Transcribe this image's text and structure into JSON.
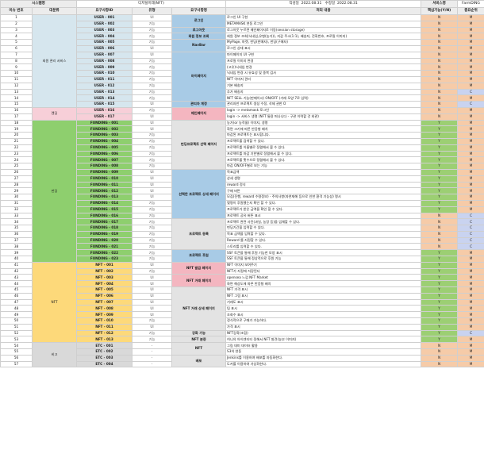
{
  "header": {
    "system_label": "시스템명",
    "system_value": "디지털미레(NFT)",
    "author_label": "작성일",
    "author_date": "2022.08.31",
    "revised_label": "수정일",
    "revised_date": "2022.08.31",
    "service_label": "서비스명",
    "service_value": "FarmDING"
  },
  "columns": [
    "이슈 번호",
    "대분류",
    "요구사항ID",
    "유형",
    "요구사항명",
    "처리 내용",
    "핵심기능(Y/N)",
    "중요순위"
  ],
  "colors": {
    "member": "#d6e6ee",
    "rental": "#f7cfd8",
    "funding": "#8ecf6e",
    "nft": "#fdd97a",
    "etc": "#d9d9d9",
    "name_blue": "#a8cbe6",
    "name_pink": "#f4b6c0",
    "name_green": "#a8d98a",
    "name_gray": "#e3e3e3",
    "core_y": "#9ccf73",
    "core_n": "#f6cba8",
    "prio_c": "#c9d3f0"
  },
  "rows": [
    {
      "no": "1",
      "id": "USER - 001",
      "type": "UI",
      "desc": "로그인 UI 구현",
      "core": "N",
      "prio": "M"
    },
    {
      "no": "2",
      "id": "USER - 002",
      "type": "기능",
      "desc": "METAMASK 연동 로그인",
      "core": "N",
      "prio": "M"
    },
    {
      "no": "3",
      "id": "USER - 003",
      "type": "기능",
      "desc": "로그아웃 누르면 메인페이지로 이동(session storage)",
      "core": "N",
      "prio": "M"
    },
    {
      "no": "4",
      "id": "USER - 004",
      "type": "기능",
      "desc": "회원 정보 조회(닉네임,유형(농가)), 지갑 주소(1:1), 배송지, 전화번호, 프로필 이미지)",
      "core": "N",
      "prio": "M"
    },
    {
      "no": "5",
      "id": "USER - 005",
      "type": "기능",
      "desc": "MyPage, 마켓, 펀딩(판매자), 펀딩(구매자)",
      "core": "N",
      "prio": "M"
    },
    {
      "no": "6",
      "id": "USER - 006",
      "type": "UI",
      "desc": "로그인 상태 표시",
      "core": "N",
      "prio": "M"
    },
    {
      "no": "7",
      "id": "USER - 007",
      "type": "UI",
      "desc": "마이페이지 UI 구현",
      "core": "N",
      "prio": "M"
    },
    {
      "no": "8",
      "id": "USER - 008",
      "type": "기능",
      "desc": "프로필 이미지 변경",
      "core": "N",
      "prio": "M"
    },
    {
      "no": "9",
      "id": "USER - 009",
      "type": "기능",
      "desc": "(고유)닉네임 변경",
      "core": "N",
      "prio": "M"
    },
    {
      "no": "10",
      "id": "USER - 010",
      "type": "기능",
      "desc": "닉네임 변경 시 유효성 및 중복 검사",
      "core": "N",
      "prio": "M"
    },
    {
      "no": "11",
      "id": "USER - 011",
      "type": "기능",
      "desc": "NFT 이미지 관리",
      "core": "N",
      "prio": "M"
    },
    {
      "no": "12",
      "id": "USER - 012",
      "type": "기능",
      "desc": "기본 배송지",
      "core": "N",
      "prio": "M"
    },
    {
      "no": "13",
      "id": "USER - 013",
      "type": "기능",
      "desc": "추가 배송지",
      "core": "N",
      "prio": "C"
    },
    {
      "no": "14",
      "id": "USER - 014",
      "type": "기능",
      "desc": "NFT SELL 기능(판매이시) ON/OFF (거래 모양 7로 입력)",
      "core": "N",
      "prio": "M"
    },
    {
      "no": "15",
      "id": "USER - 015",
      "type": "UI",
      "desc": "관리자만 프로젝트 생성 수정, 삭제 권한 O",
      "core": "N",
      "prio": "C"
    },
    {
      "no": "16",
      "id": "USER - 016",
      "type": "기능",
      "desc": "login -> metamask 로그인",
      "core": "N",
      "prio": "M"
    },
    {
      "no": "17",
      "id": "USER - 017",
      "type": "UI",
      "desc": "login -> 서비스 생명 (NFT 통용 떠나니다 - 구관 이력할 것 외관)",
      "core": "N",
      "prio": "M"
    },
    {
      "no": "18",
      "id": "FUNDING - 001",
      "type": "UI",
      "desc": "농가(or 농작물) 이미지, 생명",
      "core": "Y",
      "prio": "M"
    },
    {
      "no": "19",
      "id": "FUNDING - 002",
      "type": "UI",
      "desc": "화면 크기에 따른 반응형 배치",
      "core": "Y",
      "prio": "M"
    },
    {
      "no": "20",
      "id": "FUNDING - 003",
      "type": "기능",
      "desc": "마감된 프로젝트는 표시합니다.",
      "core": "Y",
      "prio": "M"
    },
    {
      "no": "21",
      "id": "FUNDING - 004",
      "type": "기능",
      "desc": "프로젝트를 검색할 수 있다.",
      "core": "Y",
      "prio": "M"
    },
    {
      "no": "22",
      "id": "FUNDING - 005",
      "type": "기능",
      "desc": "프로젝트를 이름별로 정렬해서 볼 수 있다.",
      "core": "Y",
      "prio": "M"
    },
    {
      "no": "23",
      "id": "FUNDING - 006",
      "type": "기능",
      "desc": "프로젝트를 마감 기한별로 정렬해서 볼 수 있다.",
      "core": "Y",
      "prio": "M"
    },
    {
      "no": "24",
      "id": "FUNDING - 007",
      "type": "기능",
      "desc": "프로젝트를 횟수으로 정렬해서 볼 수 있다.",
      "core": "Y",
      "prio": "M"
    },
    {
      "no": "25",
      "id": "FUNDING - 008",
      "type": "기능",
      "desc": "마감 ON/OFF별로 보는 기능",
      "core": "Y",
      "prio": "M"
    },
    {
      "no": "26",
      "id": "FUNDING - 009",
      "type": "UI",
      "desc": "목표금액",
      "core": "Y",
      "prio": "M"
    },
    {
      "no": "27",
      "id": "FUNDING - 010",
      "type": "UI",
      "desc": "상세 생명",
      "core": "Y",
      "prio": "M"
    },
    {
      "no": "28",
      "id": "FUNDING - 011",
      "type": "UI",
      "desc": "reward 정식",
      "core": "Y",
      "prio": "M"
    },
    {
      "no": "29",
      "id": "FUNDING - 012",
      "type": "UI",
      "desc": "구매 버튼",
      "core": "Y",
      "prio": "M"
    },
    {
      "no": "30",
      "id": "FUNDING - 013",
      "type": "UI",
      "desc": "모집(진행, reward 수령정보) - 주의사항(자연재해 등으로 인한 환격 기능성) 명시",
      "core": "Y",
      "prio": "M"
    },
    {
      "no": "31",
      "id": "FUNDING - 014",
      "type": "기능",
      "desc": "몇명이 후원했는지 확인 할 수 있다.",
      "core": "Y",
      "prio": "M"
    },
    {
      "no": "32",
      "id": "FUNDING - 015",
      "type": "기능",
      "desc": "프로젝트가 받은 금액을 확인 할 수 있다.",
      "core": "Y",
      "prio": "M"
    },
    {
      "no": "33",
      "id": "FUNDING - 016",
      "type": "기능",
      "desc": "프로젝트 공유 버튼 표시",
      "core": "N",
      "prio": "C"
    },
    {
      "no": "34",
      "id": "FUNDING - 017",
      "type": "기능",
      "desc": "프로젝트 관련 사진(과일, 농장 등)을 업체할 수 있다.",
      "core": "N",
      "prio": "C"
    },
    {
      "no": "35",
      "id": "FUNDING - 018",
      "type": "기능",
      "desc": "펀딩기간을 입력할 수 있다.",
      "core": "N",
      "prio": "C"
    },
    {
      "no": "36",
      "id": "FUNDING - 019",
      "type": "기능",
      "desc": "목표 금액을 입력할 수 있다.",
      "core": "N",
      "prio": "C"
    },
    {
      "no": "37",
      "id": "FUNDING - 020",
      "type": "기능",
      "desc": "Reward 를 지정할 수 있다.",
      "core": "N",
      "prio": "C"
    },
    {
      "no": "38",
      "id": "FUNDING - 021",
      "type": "기능",
      "desc": "스토리를 입력할 수 있다.",
      "core": "N",
      "prio": "C"
    },
    {
      "no": "39",
      "id": "FUNDING - 022",
      "type": "기능",
      "desc": "SSF 토큰을 통해 후원 기능한 모양 표시",
      "core": "Y",
      "prio": "M"
    },
    {
      "no": "40",
      "id": "FUNDING - 023",
      "type": "기능",
      "desc": "SSF 토큰을 통해 정상적으로 후원 기능",
      "core": "Y",
      "prio": "M"
    },
    {
      "no": "41",
      "id": "NFT - 001",
      "type": "UI",
      "desc": "NFT 이미지 보여주기",
      "core": "Y",
      "prio": "M"
    },
    {
      "no": "42",
      "id": "NFT - 002",
      "type": "기능",
      "desc": "NFT가 지정에 저장된다",
      "core": "Y",
      "prio": "M"
    },
    {
      "no": "43",
      "id": "NFT - 003",
      "type": "UI",
      "desc": "opensea 느낌 NFT Market",
      "core": "Y",
      "prio": "M"
    },
    {
      "no": "44",
      "id": "NFT - 004",
      "type": "UI",
      "desc": "화면 해상도에 따른 반응형 배치",
      "core": "Y",
      "prio": "M"
    },
    {
      "no": "45",
      "id": "NFT - 005",
      "type": "UI",
      "desc": "NFT 가격 표시",
      "core": "Y",
      "prio": "M"
    },
    {
      "no": "46",
      "id": "NFT - 006",
      "type": "UI",
      "desc": "NFT 그림 표시",
      "core": "Y",
      "prio": "M"
    },
    {
      "no": "47",
      "id": "NFT - 007",
      "type": "UI",
      "desc": "거래도 표시",
      "core": "Y",
      "prio": "M"
    },
    {
      "no": "48",
      "id": "NFT - 008",
      "type": "UI",
      "desc": "팀 표시",
      "core": "Y",
      "prio": "M"
    },
    {
      "no": "49",
      "id": "NFT - 009",
      "type": "UI",
      "desc": "조회수 표시",
      "core": "Y",
      "prio": "M"
    },
    {
      "no": "50",
      "id": "NFT - 010",
      "type": "기능",
      "desc": "정식적으로 구매가 가능하다.",
      "core": "Y",
      "prio": "M"
    },
    {
      "no": "51",
      "id": "NFT - 011",
      "type": "UI",
      "desc": "가격 표시",
      "core": "Y",
      "prio": "M"
    },
    {
      "no": "52",
      "id": "NFT - 012",
      "type": "기능",
      "desc": "NFT강화(조합)",
      "core": "Y",
      "prio": "C"
    },
    {
      "no": "53",
      "id": "NFT - 013",
      "type": "기능",
      "desc": "허니의 아이덴티티 정해서 NFT 발견(농부 이미지)",
      "core": "Y",
      "prio": "M"
    },
    {
      "no": "54",
      "id": "ETC - 001",
      "type": "-",
      "desc": "그림 데미 데이터 활용",
      "core": "N",
      "prio": "M"
    },
    {
      "no": "55",
      "id": "ETC - 002",
      "type": "-",
      "desc": "S3의 연동",
      "core": "N",
      "prio": "M"
    },
    {
      "no": "56",
      "id": "ETC - 003",
      "type": "-",
      "desc": "Jenkins를 이용하여 배포를 자동화한다.",
      "core": "N",
      "prio": "M"
    },
    {
      "no": "57",
      "id": "ETC - 004",
      "type": "-",
      "desc": "도커를 이용하여 가상화한다.",
      "core": "N",
      "prio": "M"
    }
  ],
  "categories": [
    {
      "label": "회원 관리 서비스",
      "start": 0,
      "span": 15,
      "color": "member"
    },
    {
      "label": "렌딩",
      "start": 15,
      "span": 2,
      "color": "rental"
    },
    {
      "label": "펀딩",
      "start": 17,
      "span": 23,
      "color": "funding"
    },
    {
      "label": "NFT",
      "start": 40,
      "span": 13,
      "color": "nft"
    },
    {
      "label": "비고",
      "start": 53,
      "span": 4,
      "color": "etc"
    }
  ],
  "names": [
    {
      "label": "로그인",
      "start": 0,
      "span": 2,
      "color": "name_blue"
    },
    {
      "label": "로그아웃",
      "start": 2,
      "span": 1,
      "color": "name_blue"
    },
    {
      "label": "회원 정보 조회",
      "start": 3,
      "span": 1,
      "color": "name_blue"
    },
    {
      "label": "NavBar",
      "start": 4,
      "span": 2,
      "color": "name_blue"
    },
    {
      "label": "마이페이지",
      "start": 6,
      "span": 8,
      "color": "name_blue"
    },
    {
      "label": "관리자 계정",
      "start": 14,
      "span": 1,
      "color": "name_blue"
    },
    {
      "label": "메인페이지",
      "start": 15,
      "span": 2,
      "color": "name_pink"
    },
    {
      "label": "펀딩프로젝트 선택 페이지",
      "start": 17,
      "span": 8,
      "color": "name_gray"
    },
    {
      "label": "선택한 프로젝트 상세 페이지",
      "start": 25,
      "span": 8,
      "color": "name_blue"
    },
    {
      "label": "프로젝트 등록",
      "start": 33,
      "span": 5,
      "color": "name_gray"
    },
    {
      "label": "프로젝트 후원",
      "start": 38,
      "span": 2,
      "color": "name_blue"
    },
    {
      "label": "NFT 발급 페이지",
      "start": 40,
      "span": 2,
      "color": "name_pink"
    },
    {
      "label": "NFT 거래 페이지",
      "start": 42,
      "span": 2,
      "color": "name_pink"
    },
    {
      "label": "NFT 거래 상세 페이지",
      "start": 44,
      "span": 7,
      "color": "name_gray"
    },
    {
      "label": "강화 기능",
      "start": 51,
      "span": 1,
      "color": "name_gray"
    },
    {
      "label": "NFT 분증",
      "start": 52,
      "span": 1,
      "color": "name_gray"
    },
    {
      "label": "NFT",
      "start": 53,
      "span": 2,
      "color": "name_gray"
    },
    {
      "label": "배포",
      "start": 55,
      "span": 2,
      "color": "name_gray"
    }
  ]
}
